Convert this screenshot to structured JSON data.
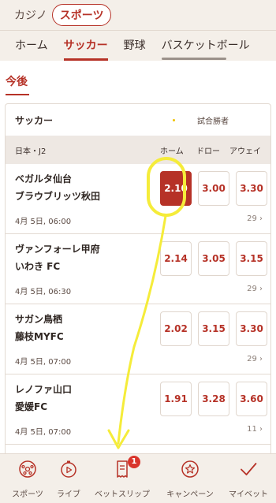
{
  "topbar": {
    "casino_label": "カジノ",
    "sports_label": "スポーツ"
  },
  "subnav": {
    "tabs": [
      "ホーム",
      "サッカー",
      "野球",
      "バスケットボール"
    ],
    "active_index": 1
  },
  "section": {
    "title": "今後"
  },
  "card": {
    "sport": "サッカー",
    "events_label": "試合勝者",
    "league": "日本・J2",
    "columns": [
      "ホーム",
      "ドロー",
      "アウェイ"
    ],
    "matches": [
      {
        "team1": "ベガルタ仙台",
        "team2": "ブラウブリッツ秋田",
        "time": "4月 5日, 06:00",
        "more": "29",
        "odds": [
          "2.10",
          "3.00",
          "3.30"
        ],
        "selected": 0
      },
      {
        "team1": "ヴァンフォーレ甲府",
        "team2": "いわき FC",
        "time": "4月 5日, 06:30",
        "more": "29",
        "odds": [
          "2.14",
          "3.05",
          "3.15"
        ],
        "selected": -1
      },
      {
        "team1": "サガン鳥栖",
        "team2": "藤枝MYFC",
        "time": "4月 5日, 07:00",
        "more": "29",
        "odds": [
          "2.02",
          "3.15",
          "3.30"
        ],
        "selected": -1
      },
      {
        "team1": "レノファ山口",
        "team2": "愛媛FC",
        "time": "4月 5日, 07:00",
        "more": "11",
        "odds": [
          "1.91",
          "3.28",
          "3.60"
        ],
        "selected": -1
      }
    ]
  },
  "bottomnav": {
    "items": [
      {
        "label": "スポーツ",
        "icon": "soccer-ball-icon"
      },
      {
        "label": "ライブ",
        "icon": "stopwatch-play-icon"
      },
      {
        "label": "ベットスリップ",
        "icon": "receipt-icon"
      },
      {
        "label": "キャンペーン",
        "icon": "star-circle-icon"
      },
      {
        "label": "マイベット",
        "icon": "checkmark-icon"
      }
    ],
    "betslip_badge": "1"
  },
  "colors": {
    "accent": "#b63227",
    "annotation": "#f5ec3a",
    "background": "#f4efe9"
  }
}
